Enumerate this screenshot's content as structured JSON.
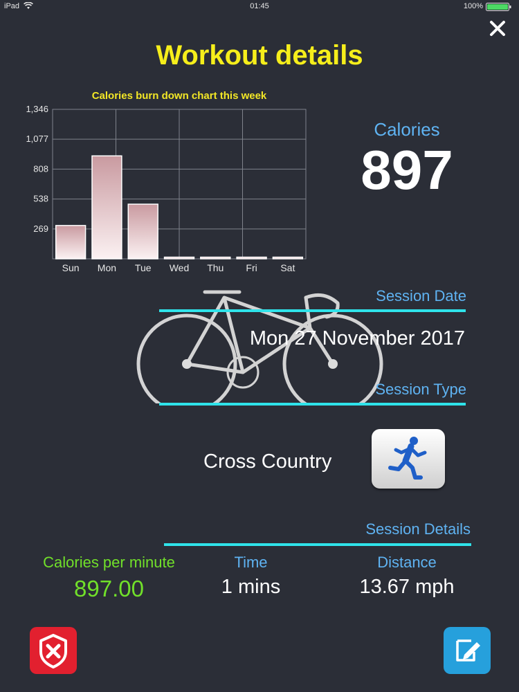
{
  "status_bar": {
    "device": "iPad",
    "time": "01:45",
    "battery": "100%"
  },
  "header": {
    "title": "Workout details"
  },
  "chart_data": {
    "type": "bar",
    "title": "Calories burn down chart this week",
    "categories": [
      "Sun",
      "Mon",
      "Tue",
      "Wed",
      "Thu",
      "Fri",
      "Sat"
    ],
    "values": [
      300,
      927,
      492,
      15,
      15,
      15,
      15
    ],
    "ylim": [
      0,
      1346
    ],
    "yticks": [
      "269",
      "538",
      "808",
      "1,077",
      "1,346"
    ],
    "ytick_values": [
      269,
      538,
      808,
      1077,
      1346
    ],
    "grid": true
  },
  "calories": {
    "label": "Calories",
    "value": "897"
  },
  "session_date": {
    "label": "Session Date",
    "value": "Mon 27 November 2017"
  },
  "session_type": {
    "label": "Session Type",
    "value": "Cross Country"
  },
  "session_details": {
    "label": "Session Details",
    "calories_per_minute": {
      "label": "Calories per minute",
      "value": "897.00"
    },
    "time": {
      "label": "Time",
      "value": "1 mins"
    },
    "distance": {
      "label": "Distance",
      "value": "13.67 mph"
    }
  },
  "colors": {
    "background": "#2b2e37",
    "title": "#f6ee1b",
    "accent_blue": "#5fb3f2",
    "rule": "#2fe3ea",
    "green": "#71e02a",
    "delete": "#e2202f",
    "edit": "#26a0dc"
  },
  "icons": {
    "close": "close-icon",
    "bike": "bike-icon",
    "runner": "runner-icon",
    "delete": "shield-x-icon",
    "edit": "edit-note-icon"
  }
}
